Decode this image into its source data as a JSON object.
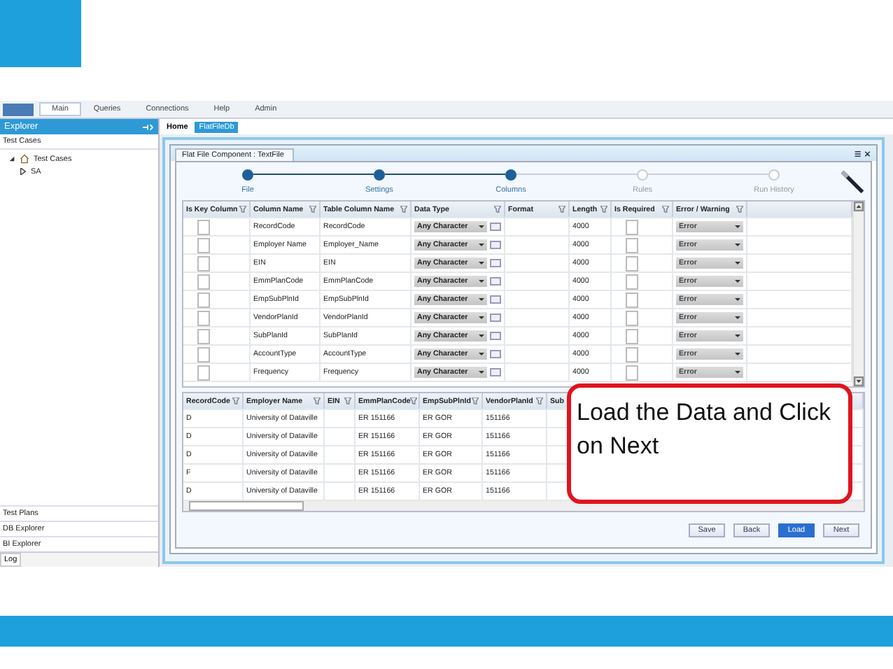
{
  "menu_tabs": [
    {
      "label": "Main",
      "selected": true
    },
    {
      "label": "Queries",
      "selected": false
    },
    {
      "label": "Connections",
      "selected": false
    },
    {
      "label": "Help",
      "selected": false
    },
    {
      "label": "Admin",
      "selected": false
    }
  ],
  "explorer": {
    "title": "Explorer",
    "section": "Test Cases",
    "tree": [
      {
        "label": "Test Cases",
        "expanded": true,
        "children": [
          {
            "label": "SA",
            "expanded": false
          }
        ]
      }
    ],
    "bottom_panels": [
      "Test Plans",
      "DB Explorer",
      "BI Explorer"
    ],
    "log_tab": "Log"
  },
  "doc_tabs": [
    {
      "label": "Home",
      "selected": false
    },
    {
      "label": "FlatFileDb",
      "selected": true
    }
  ],
  "component": {
    "title": "Flat File Component : TextFile",
    "steps": [
      {
        "label": "File",
        "done": true
      },
      {
        "label": "Settings",
        "done": true
      },
      {
        "label": "Columns",
        "done": true
      },
      {
        "label": "Rules",
        "done": false
      },
      {
        "label": "Run History",
        "done": false
      }
    ],
    "columns_grid": {
      "columns": [
        "Is Key Column",
        "Column Name",
        "Table Column Name",
        "Data Type",
        "Format",
        "Length",
        "Is Required",
        "Error / Warning"
      ],
      "rows": [
        {
          "is_key": false,
          "column_name": "RecordCode",
          "table_column_name": "RecordCode",
          "data_type": "Any Character",
          "length": "4000",
          "required": false,
          "severity": "Error"
        },
        {
          "is_key": false,
          "column_name": "Employer Name",
          "table_column_name": "Employer_Name",
          "data_type": "Any Character",
          "length": "4000",
          "required": false,
          "severity": "Error"
        },
        {
          "is_key": false,
          "column_name": "EIN",
          "table_column_name": "EIN",
          "data_type": "Any Character",
          "length": "4000",
          "required": false,
          "severity": "Error"
        },
        {
          "is_key": false,
          "column_name": "EmmPlanCode",
          "table_column_name": "EmmPlanCode",
          "data_type": "Any Character",
          "length": "4000",
          "required": false,
          "severity": "Error"
        },
        {
          "is_key": false,
          "column_name": "EmpSubPlnId",
          "table_column_name": "EmpSubPlnId",
          "data_type": "Any Character",
          "length": "4000",
          "required": false,
          "severity": "Error"
        },
        {
          "is_key": false,
          "column_name": "VendorPlanId",
          "table_column_name": "VendorPlanId",
          "data_type": "Any Character",
          "length": "4000",
          "required": false,
          "severity": "Error"
        },
        {
          "is_key": false,
          "column_name": "SubPlanId",
          "table_column_name": "SubPlanId",
          "data_type": "Any Character",
          "length": "4000",
          "required": false,
          "severity": "Error"
        },
        {
          "is_key": false,
          "column_name": "AccountType",
          "table_column_name": "AccountType",
          "data_type": "Any Character",
          "length": "4000",
          "required": false,
          "severity": "Error"
        },
        {
          "is_key": false,
          "column_name": "Frequency",
          "table_column_name": "Frequency",
          "data_type": "Any Character",
          "length": "4000",
          "required": false,
          "severity": "Error"
        }
      ]
    },
    "preview_grid": {
      "columns": [
        "RecordCode",
        "Employer Name",
        "EIN",
        "EmmPlanCode",
        "EmpSubPlnId",
        "VendorPlanId",
        "Sub"
      ],
      "rows": [
        [
          "D",
          "University of Dataville",
          "",
          "ER 151166",
          "ER GOR",
          "151166"
        ],
        [
          "D",
          "University of Dataville",
          "",
          "ER 151166",
          "ER GOR",
          "151166"
        ],
        [
          "D",
          "University of Dataville",
          "",
          "ER 151166",
          "ER GOR",
          "151166"
        ],
        [
          "F",
          "University of Dataville",
          "",
          "ER 151166",
          "ER GOR",
          "151166"
        ],
        [
          "D",
          "University of Dataville",
          "",
          "ER 151166",
          "ER GOR",
          "151166"
        ]
      ]
    },
    "buttons": [
      {
        "label": "Save",
        "primary": false
      },
      {
        "label": "Back",
        "primary": false
      },
      {
        "label": "Load",
        "primary": true
      },
      {
        "label": "Next",
        "primary": false
      }
    ]
  },
  "callout": "Load the Data and Click on Next"
}
